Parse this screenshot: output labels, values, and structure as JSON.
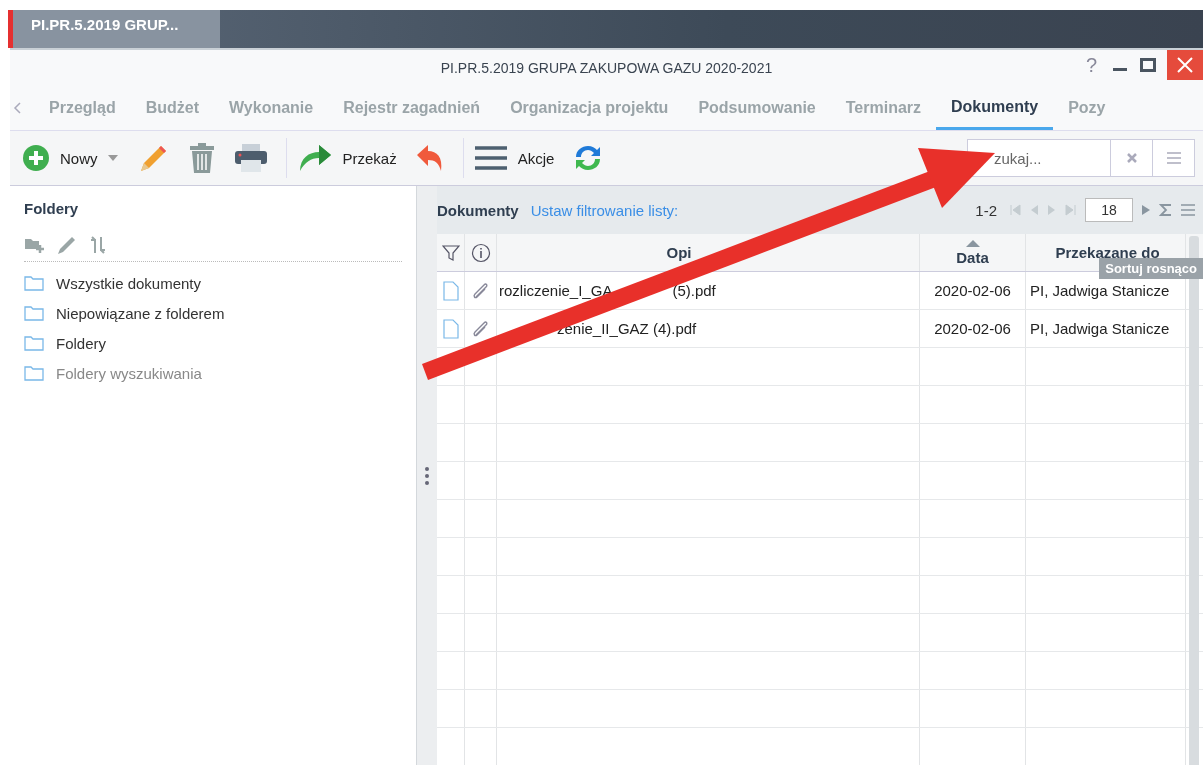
{
  "taskbar": {
    "tab": "PI.PR.5.2019 GRUP..."
  },
  "window": {
    "title": "PI.PR.5.2019 GRUPA ZAKUPOWA GAZU 2020-2021",
    "help": "?"
  },
  "tabs": [
    {
      "label": "Przegląd",
      "selected": false
    },
    {
      "label": "Budżet",
      "selected": false
    },
    {
      "label": "Wykonanie",
      "selected": false
    },
    {
      "label": "Rejestr zagadnień",
      "selected": false
    },
    {
      "label": "Organizacja projektu",
      "selected": false
    },
    {
      "label": "Podsumowanie",
      "selected": false
    },
    {
      "label": "Terminarz",
      "selected": false
    },
    {
      "label": "Dokumenty",
      "selected": true
    },
    {
      "label": "Pozy",
      "selected": false
    }
  ],
  "toolbar": [
    {
      "kind": "new",
      "label": "Nowy"
    },
    {
      "kind": "edit"
    },
    {
      "kind": "delete"
    },
    {
      "kind": "print"
    },
    {
      "kind": "forward",
      "label": "Przekaż"
    },
    {
      "kind": "undo"
    },
    {
      "kind": "actions",
      "label": "Akcje"
    },
    {
      "kind": "refresh"
    }
  ],
  "search": {
    "placeholder": "zukaj..."
  },
  "folders": {
    "title": "Foldery",
    "items": [
      {
        "label": "Wszystkie dokumenty",
        "disabled": false
      },
      {
        "label": "Niepowiązane z folderem",
        "disabled": false
      },
      {
        "label": "Foldery",
        "disabled": false
      },
      {
        "label": "Foldery wyszukiwania",
        "disabled": true
      }
    ]
  },
  "documents": {
    "title": "Dokumenty",
    "filter_link": "Ustaw filtrowanie listy:",
    "range": "1-2",
    "page_size": "18",
    "columns": [
      "Opi",
      "Data",
      "Przekazane do"
    ],
    "rows": [
      {
        "name_parts": [
          "rozliczenie_I_GA",
          "(5).pdf"
        ],
        "covered_start": false,
        "date": "2020-02-06",
        "to": "PI, Jadwiga Stanicze"
      },
      {
        "name_parts": [
          "zenie_II_GAZ (4).pdf"
        ],
        "covered_start": true,
        "date": "2020-02-06",
        "to": "PI, Jadwiga Stanicze"
      }
    ],
    "tooltip": "Sortuj rosnąco"
  }
}
